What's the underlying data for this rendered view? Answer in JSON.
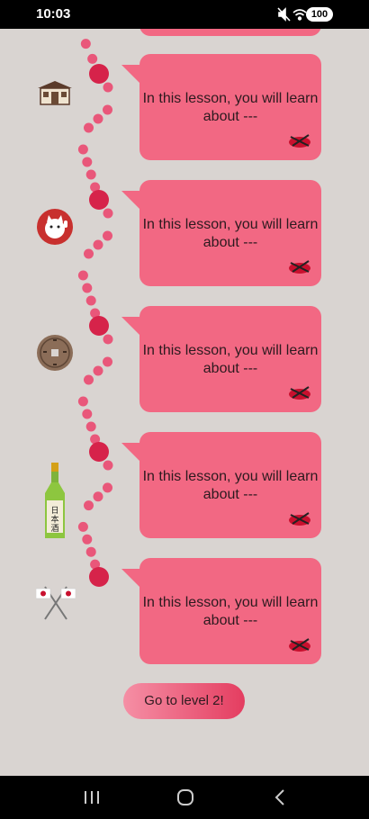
{
  "status_bar": {
    "time": "10:03",
    "battery": "100",
    "icons": [
      "mute-icon",
      "wifi-icon",
      "signal-icon"
    ]
  },
  "lessons": [
    {
      "text": "In this lesson, you will learn about ---",
      "icon": "japanese-house-icon",
      "badge_icon": "sushi-icon"
    },
    {
      "text": "In this lesson, you will learn about ---",
      "icon": "lucky-cat-icon",
      "badge_icon": "sushi-icon"
    },
    {
      "text": "In this lesson, you will learn about ---",
      "icon": "japanese-coin-icon",
      "badge_icon": "sushi-icon"
    },
    {
      "text": "In this lesson, you will learn about ---",
      "icon": "sake-bottle-icon",
      "badge_icon": "sushi-icon"
    },
    {
      "text": "In this lesson, you will learn about ---",
      "icon": "crossed-flags-icon",
      "badge_icon": "sushi-icon"
    }
  ],
  "level_button": {
    "label": "Go to level 2!"
  },
  "sake_label": "日本酒",
  "colors": {
    "background": "#d9d4d1",
    "card": "#f26883",
    "path_dot": "#e9577a",
    "node": "#d6234a"
  },
  "nav_bar": {
    "icons": [
      "recent-apps-icon",
      "home-icon",
      "back-icon"
    ]
  }
}
